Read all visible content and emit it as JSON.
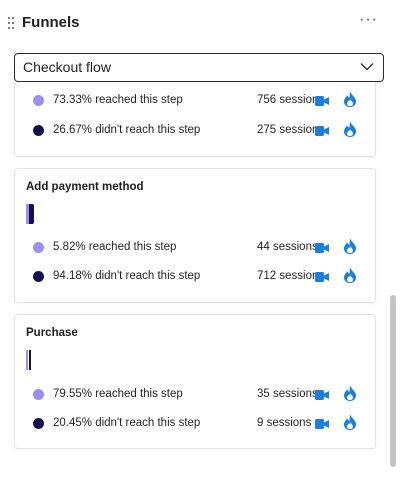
{
  "header": {
    "title": "Funnels",
    "more_icon": "ellipsis-icon",
    "grip_icon": "drag-grip-icon"
  },
  "funnel_select": {
    "value": "Checkout flow",
    "icon": "chevron-down-icon"
  },
  "colors": {
    "reached": "#9b8fef",
    "not_reached": "#14124a",
    "action_blue": "#1d7fd9"
  },
  "steps": [
    {
      "title": "",
      "reached_fraction": 0.7333,
      "rows": [
        {
          "label": "73.33% reached this step",
          "sessions": "756 sessions"
        },
        {
          "label": "26.67% didn't reach this step",
          "sessions": "275 sessions"
        }
      ]
    },
    {
      "title": "Add payment method",
      "reached_fraction": 0.0582,
      "rows": [
        {
          "label": "5.82% reached this step",
          "sessions": "44 sessions"
        },
        {
          "label": "94.18% didn't reach this step",
          "sessions": "712 sessions"
        }
      ]
    },
    {
      "title": "Purchase",
      "reached_fraction": 0.7955,
      "rows": [
        {
          "label": "79.55% reached this step",
          "sessions": "35 sessions"
        },
        {
          "label": "20.45% didn't reach this step",
          "sessions": "9 sessions"
        }
      ]
    }
  ]
}
